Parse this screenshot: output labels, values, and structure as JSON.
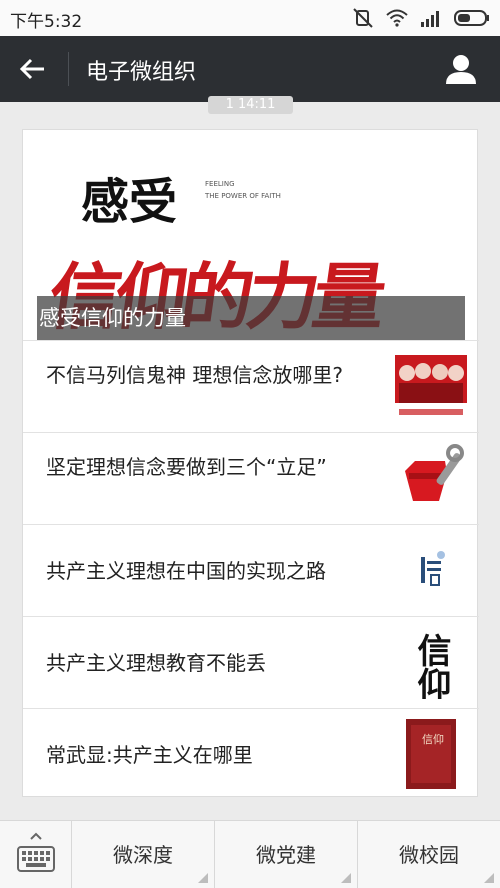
{
  "status_bar": {
    "time": "下午5:32",
    "icons": [
      "mute-icon",
      "wifi-icon",
      "signal-icon",
      "battery-icon"
    ]
  },
  "app_bar": {
    "title": "电子微组织",
    "icons": [
      "back-arrow-icon",
      "profile-icon"
    ]
  },
  "timestamp_pill": "1 14:11",
  "cover_article": {
    "title": "感受信仰的力量",
    "art_heading": "感受",
    "art_sub_1": "FEELING",
    "art_sub_2": "THE POWER OF FAITH",
    "art_calligraphy": "信仰的力量"
  },
  "articles": [
    {
      "title": "不信马列信鬼神 理想信念放哪里?"
    },
    {
      "title": "坚定理想信念要做到三个“立足”"
    },
    {
      "title": "共产主义理想在中国的实现之路"
    },
    {
      "title": "共产主义理想教育不能丢",
      "thumb_text": "信仰"
    },
    {
      "title": "常武显:共产主义在哪里",
      "thumb_text": "信仰"
    }
  ],
  "bottom_bar": {
    "tabs": [
      {
        "label": "微深度"
      },
      {
        "label": "微党建"
      },
      {
        "label": "微校园"
      }
    ]
  },
  "colors": {
    "app_bar_bg": "#2c2f33",
    "accent_red": "#c8191e"
  }
}
